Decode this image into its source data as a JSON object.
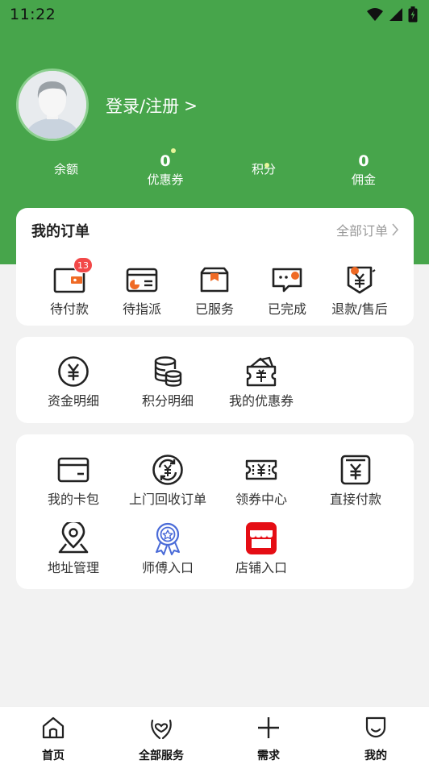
{
  "status_bar": {
    "time": "11:22"
  },
  "profile": {
    "login_label": "登录/注册",
    "chevron": ">"
  },
  "stats": [
    {
      "value": "",
      "label": "余额"
    },
    {
      "value": "0",
      "label": "优惠券"
    },
    {
      "value": "",
      "label": "积分"
    },
    {
      "value": "0",
      "label": "佣金"
    }
  ],
  "orders": {
    "title": "我的订单",
    "all_label": "全部订单",
    "items": [
      {
        "label": "待付款",
        "icon": "wallet-icon",
        "badge": "13"
      },
      {
        "label": "待指派",
        "icon": "card-pie-icon"
      },
      {
        "label": "已服务",
        "icon": "box-icon"
      },
      {
        "label": "已完成",
        "icon": "chat-done-icon"
      },
      {
        "label": "退款/售后",
        "icon": "refund-icon"
      }
    ]
  },
  "assets": {
    "items": [
      {
        "label": "资金明细",
        "icon": "yen-circle-icon"
      },
      {
        "label": "积分明细",
        "icon": "coins-stack-icon"
      },
      {
        "label": "我的优惠券",
        "icon": "coupon-wallet-icon"
      }
    ]
  },
  "services": {
    "items": [
      {
        "label": "我的卡包",
        "icon": "card-icon"
      },
      {
        "label": "上门回收订单",
        "icon": "recycle-yen-icon"
      },
      {
        "label": "领券中心",
        "icon": "ticket-icon"
      },
      {
        "label": "直接付款",
        "icon": "pay-receipt-icon"
      },
      {
        "label": "地址管理",
        "icon": "location-pin-icon"
      },
      {
        "label": "师傅入口",
        "icon": "medal-icon"
      },
      {
        "label": "店铺入口",
        "icon": "shop-icon"
      }
    ]
  },
  "tabbar": [
    {
      "label": "首页",
      "icon": "home-icon"
    },
    {
      "label": "全部服务",
      "icon": "heart-hands-icon"
    },
    {
      "label": "需求",
      "icon": "plus-icon"
    },
    {
      "label": "我的",
      "icon": "smile-icon"
    }
  ],
  "colors": {
    "brand_green": "#47a54b",
    "badge_red": "#f24848",
    "accent_orange": "#ef6a25"
  }
}
